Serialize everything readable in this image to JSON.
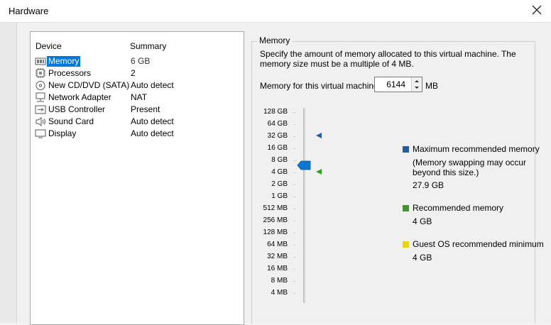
{
  "window": {
    "title": "Hardware"
  },
  "device_list": {
    "headers": {
      "device": "Device",
      "summary": "Summary"
    },
    "items": [
      {
        "name": "Memory",
        "summary": "6 GB",
        "icon": "memory-icon",
        "selected": true
      },
      {
        "name": "Processors",
        "summary": "2",
        "icon": "processor-icon"
      },
      {
        "name": "New CD/DVD (SATA)",
        "summary": "Auto detect",
        "icon": "cd-dvd-icon"
      },
      {
        "name": "Network Adapter",
        "summary": "NAT",
        "icon": "network-adapter-icon"
      },
      {
        "name": "USB Controller",
        "summary": "Present",
        "icon": "usb-icon"
      },
      {
        "name": "Sound Card",
        "summary": "Auto detect",
        "icon": "speaker-icon"
      },
      {
        "name": "Display",
        "summary": "Auto detect",
        "icon": "display-icon"
      }
    ]
  },
  "memory": {
    "group_label": "Memory",
    "description": "Specify the amount of memory allocated to this virtual machine. The memory size must be a multiple of 4 MB.",
    "field_label": "Memory for this virtual machine:",
    "value": "6144",
    "unit": "MB",
    "scale_labels": [
      "128 GB",
      "64 GB",
      "32 GB",
      "16 GB",
      "8 GB",
      "4 GB",
      "2 GB",
      "1 GB",
      "512 MB",
      "256 MB",
      "128 MB",
      "64 MB",
      "32 MB",
      "16 MB",
      "8 MB",
      "4 MB"
    ],
    "legend": {
      "max": {
        "label": "Maximum recommended memory",
        "note": "(Memory swapping may occur beyond this size.)",
        "value": "27.9 GB",
        "color": "#1f5fa8"
      },
      "rec": {
        "label": "Recommended memory",
        "value": "4 GB",
        "color": "#3a9a2c"
      },
      "min": {
        "label": "Guest OS recommended minimum",
        "value": "4 GB",
        "color": "#f2d100"
      }
    },
    "colors": {
      "thumb": "#0a78d1"
    }
  }
}
